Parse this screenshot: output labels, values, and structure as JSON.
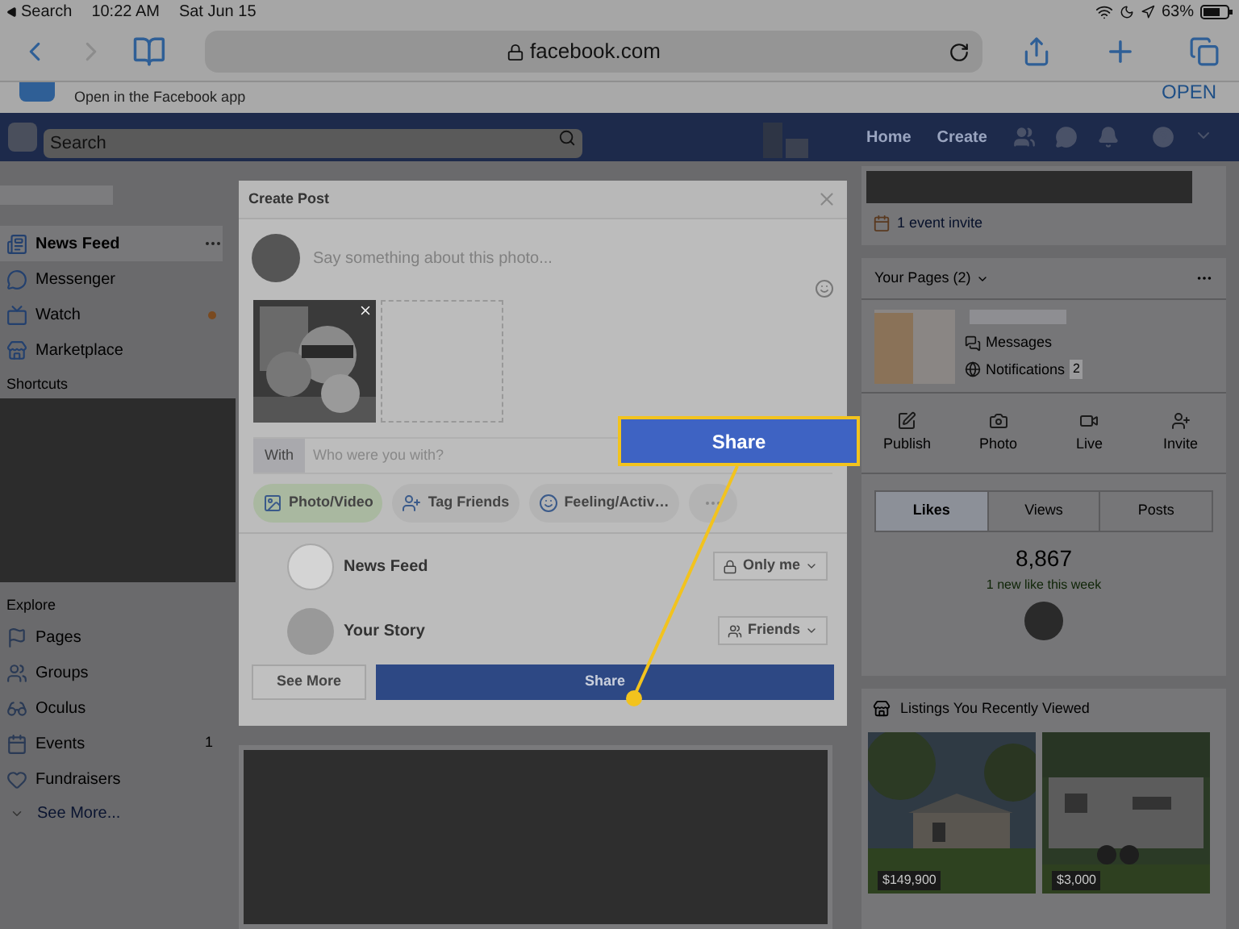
{
  "status_bar": {
    "back_label": "Search",
    "time": "10:22 AM",
    "date": "Sat Jun 15",
    "battery": "63%"
  },
  "browser": {
    "url": "facebook.com"
  },
  "app_banner": {
    "text": "Open in the Facebook app",
    "button": "OPEN"
  },
  "navbar": {
    "search_placeholder": "Search",
    "links": [
      "Home",
      "Create"
    ]
  },
  "sidebar": {
    "items": [
      {
        "label": "News Feed",
        "selected": true,
        "dot": false
      },
      {
        "label": "Messenger",
        "selected": false,
        "dot": false
      },
      {
        "label": "Watch",
        "selected": false,
        "dot": true
      },
      {
        "label": "Marketplace",
        "selected": false,
        "dot": false
      }
    ],
    "shortcuts_title": "Shortcuts",
    "explore_title": "Explore",
    "explore_items": [
      {
        "label": "Pages"
      },
      {
        "label": "Groups"
      },
      {
        "label": "Oculus"
      },
      {
        "label": "Events",
        "count": "1"
      },
      {
        "label": "Fundraisers"
      }
    ],
    "see_more": "See More..."
  },
  "dialog": {
    "title": "Create Post",
    "placeholder": "Say something about this photo...",
    "with_label": "With",
    "with_placeholder": "Who were you with?",
    "actions": [
      {
        "label": "Photo/Video",
        "selected": true
      },
      {
        "label": "Tag Friends",
        "selected": false
      },
      {
        "label": "Feeling/Activ…",
        "selected": false
      }
    ],
    "destinations": [
      {
        "label": "News Feed",
        "audience": "Only me"
      },
      {
        "label": "Your Story",
        "audience": "Friends"
      }
    ],
    "see_more": "See More",
    "share": "Share"
  },
  "callout": {
    "label": "Share"
  },
  "right": {
    "event_invite": "1 event invite",
    "pages_title": "Your Pages (2)",
    "messages": "Messages",
    "notifications": "Notifications",
    "notifications_count": "2",
    "page_actions": [
      "Publish",
      "Photo",
      "Live",
      "Invite"
    ],
    "tabs": [
      {
        "label": "Likes",
        "selected": true
      },
      {
        "label": "Views",
        "selected": false
      },
      {
        "label": "Posts",
        "selected": false
      }
    ],
    "likes": "8,867",
    "likes_note": "1 new like this week",
    "listings_title": "Listings You Recently Viewed",
    "listings": [
      {
        "price": "$149,900"
      },
      {
        "price": "$3,000"
      }
    ]
  }
}
